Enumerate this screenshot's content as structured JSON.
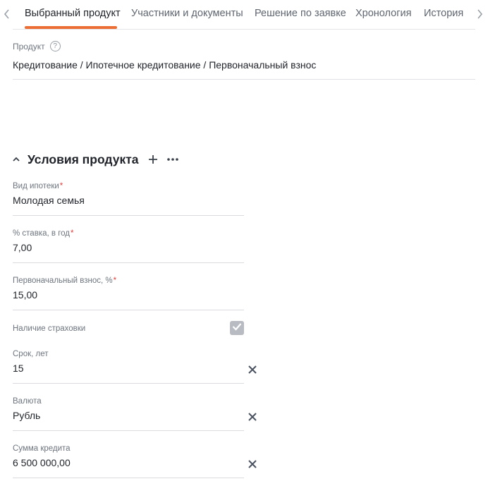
{
  "tabs": {
    "items": [
      {
        "label": "Выбранный продукт",
        "active": true
      },
      {
        "label": "Участники и документы",
        "active": false
      },
      {
        "label": "Решение по заявке",
        "active": false
      },
      {
        "label": "Хронология",
        "active": false
      },
      {
        "label": "История",
        "active": false
      }
    ],
    "accent_color": "#ed6e35"
  },
  "product": {
    "label": "Продукт",
    "help_glyph": "?",
    "value": "Кредитование / Ипотечное кредитование / Первоначальный взнос"
  },
  "section": {
    "title": "Условия продукта"
  },
  "fields": {
    "mortgage_type": {
      "label": "Вид ипотеки",
      "value": "Молодая семья",
      "required": "*"
    },
    "rate": {
      "label": "% ставка, в год",
      "value": "7,00",
      "required": "*"
    },
    "down_payment": {
      "label": "Первоначальный взнос, %",
      "value": "15,00",
      "required": "*"
    },
    "insurance": {
      "label": "Наличие страховки",
      "checked": true
    },
    "term": {
      "label": "Срок, лет",
      "value": "15"
    },
    "currency": {
      "label": "Валюта",
      "value": "Рубль"
    },
    "amount": {
      "label": "Сумма кредита",
      "value": "6 500 000,00"
    }
  },
  "icons": {
    "tab_prev": "chevron-left-icon",
    "tab_next": "chevron-right-icon",
    "collapse": "chevron-up-icon",
    "add": "plus-icon",
    "more": "more-horizontal-icon",
    "clear": "close-icon",
    "check": "check-icon",
    "help": "help-circle-icon"
  }
}
